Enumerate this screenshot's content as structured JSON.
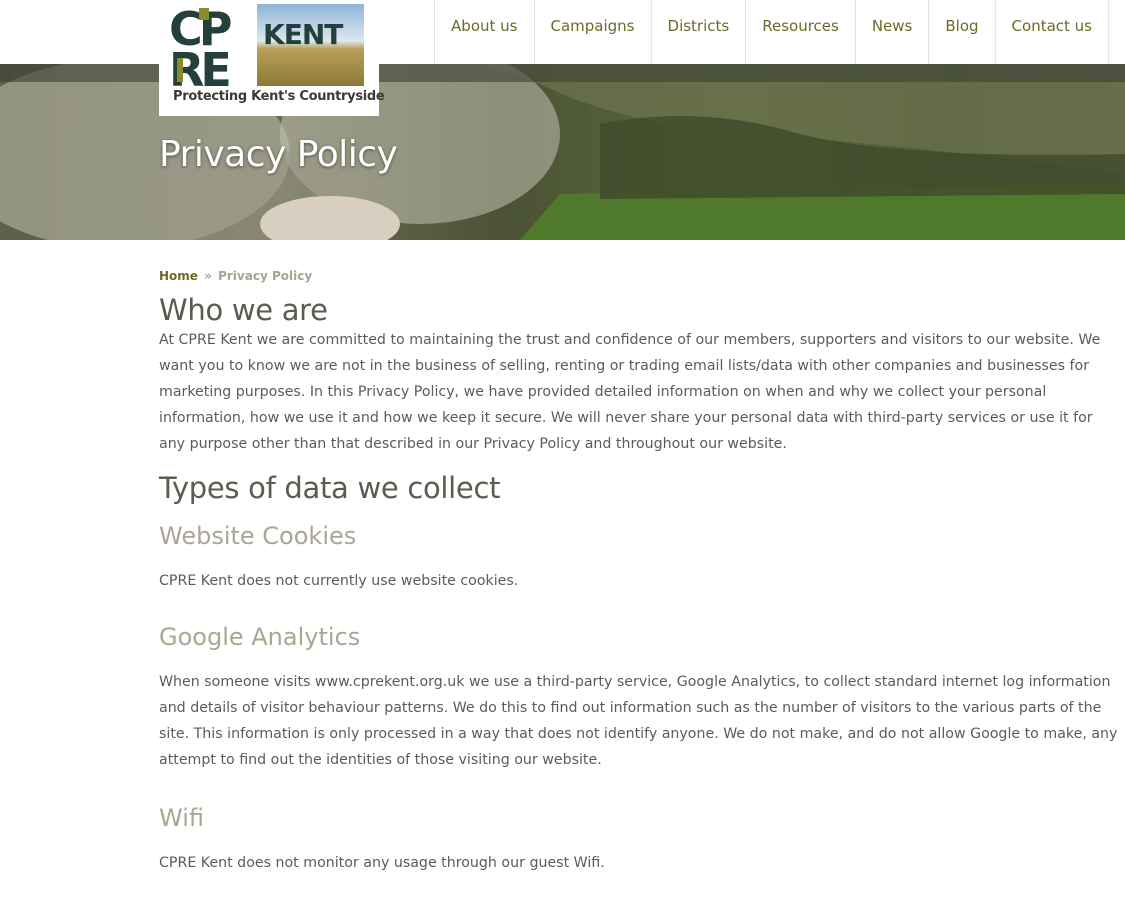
{
  "logo": {
    "letters_left": "CP",
    "letters_left2": "RE",
    "brand_right": "KENT",
    "tagline": "Protecting Kent's Countryside"
  },
  "nav": {
    "items": [
      {
        "label": "About us"
      },
      {
        "label": "Campaigns"
      },
      {
        "label": "Districts"
      },
      {
        "label": "Resources"
      },
      {
        "label": "News"
      },
      {
        "label": "Blog"
      },
      {
        "label": "Contact us"
      }
    ]
  },
  "hero": {
    "title": "Privacy Policy"
  },
  "breadcrumb": {
    "home": "Home",
    "separator": "»",
    "current": "Privacy Policy"
  },
  "sections": {
    "who_title": "Who we are",
    "who_text": "At CPRE Kent we are committed to maintaining the trust and confidence of our members, supporters and visitors to our website. We want you to know we are not in the business of selling, renting or trading email lists/data with other companies and businesses for marketing purposes. In this Privacy Policy, we have provided detailed information on when and why we collect your personal information, how we use it and how we keep it secure. We will never share your personal data with third-party services or use it for any purpose other than that described in our Privacy Policy and throughout our website.",
    "types_title": "Types of data we collect",
    "cookies_title": "Website Cookies",
    "cookies_text": "CPRE Kent does not currently use website cookies.",
    "analytics_title": "Google Analytics",
    "analytics_text": "When someone visits www.cprekent.org.uk we use a third-party service, Google Analytics, to collect standard internet log information and details of visitor behaviour patterns. We do this to find out information such as the number of visitors to the various parts of the site. This information is only processed in a way that does not identify anyone. We do not make, and do not allow Google to make, any attempt to find out the identities of those visiting our website.",
    "wifi_title": "Wifi",
    "wifi_text": "CPRE Kent does not monitor any usage through our guest Wifi."
  },
  "colors": {
    "nav_text": "#6d6a27",
    "heading": "#5d5a4f",
    "subheading": "#aba694",
    "body_text": "#5f5b54",
    "logo_dark": "#24403c",
    "logo_olive": "#8b8a2c"
  }
}
